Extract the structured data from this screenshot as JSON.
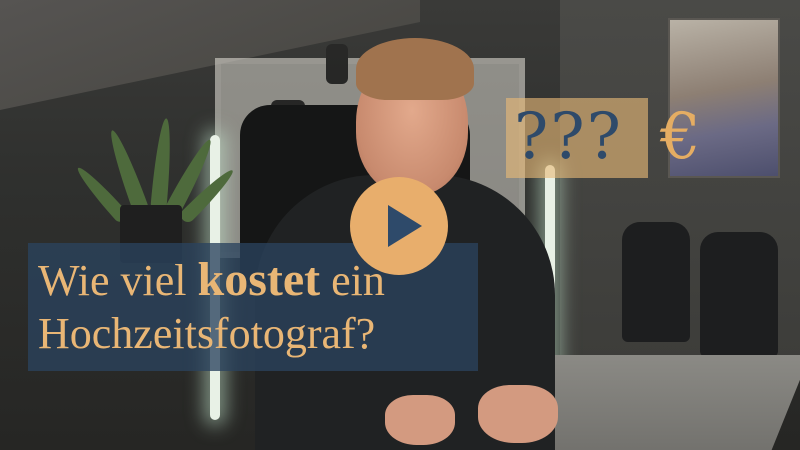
{
  "video": {
    "title_line1_pre": "Wie viel ",
    "title_line1_bold": "kostet",
    "title_line1_post": " ein",
    "title_line2": "Hochzeitsfotograf?",
    "price_question": "???",
    "currency_symbol": "€"
  },
  "play_button": {
    "icon": "play-icon"
  },
  "colors": {
    "accent_gold": "#e8ae6c",
    "navy": "#2e4a6a",
    "title_box": "#2a425e"
  }
}
